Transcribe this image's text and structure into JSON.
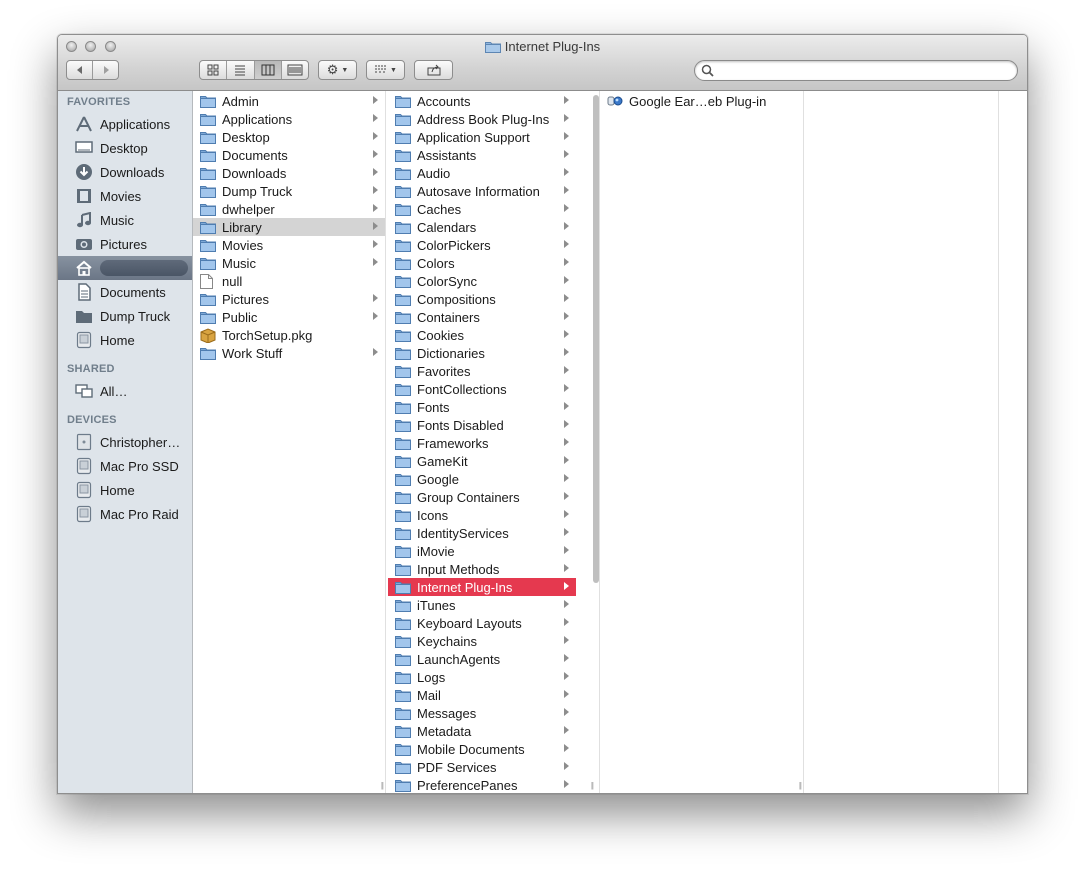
{
  "window": {
    "title": "Internet Plug-Ins"
  },
  "toolbar": {
    "back_icon": "back-arrow-icon",
    "forward_icon": "forward-arrow-icon",
    "views": [
      "icon-view-icon",
      "list-view-icon",
      "column-view-icon",
      "coverflow-view-icon"
    ],
    "active_view": "column",
    "action_icon": "gear-icon",
    "arrange_icon": "arrange-icon",
    "share_icon": "share-icon",
    "search": {
      "value": "",
      "placeholder": ""
    }
  },
  "sidebar": {
    "favorites_header": "FAVORITES",
    "favorites": [
      {
        "label": "Applications",
        "icon": "applications-icon"
      },
      {
        "label": "Desktop",
        "icon": "desktop-icon"
      },
      {
        "label": "Downloads",
        "icon": "downloads-icon"
      },
      {
        "label": "Movies",
        "icon": "movies-icon"
      },
      {
        "label": "Music",
        "icon": "music-icon"
      },
      {
        "label": "Pictures",
        "icon": "pictures-icon"
      },
      {
        "label": "",
        "icon": "home-icon",
        "selected": true
      },
      {
        "label": "Documents",
        "icon": "documents-icon"
      },
      {
        "label": "Dump Truck",
        "icon": "folder-icon"
      },
      {
        "label": "Home",
        "icon": "drive-icon"
      }
    ],
    "shared_header": "SHARED",
    "shared": [
      {
        "label": "All…",
        "icon": "network-icon"
      }
    ],
    "devices_header": "DEVICES",
    "devices": [
      {
        "label": "Christopher…",
        "icon": "computer-icon"
      },
      {
        "label": "Mac Pro SSD",
        "icon": "drive-icon"
      },
      {
        "label": "Home",
        "icon": "drive-icon"
      },
      {
        "label": "Mac Pro Raid",
        "icon": "drive-icon"
      }
    ]
  },
  "column1": {
    "selected": "Library",
    "items": [
      {
        "label": "Admin",
        "kind": "folder",
        "arrow": true
      },
      {
        "label": "Applications",
        "kind": "folder",
        "arrow": true
      },
      {
        "label": "Desktop",
        "kind": "folder",
        "arrow": true
      },
      {
        "label": "Documents",
        "kind": "folder",
        "arrow": true
      },
      {
        "label": "Downloads",
        "kind": "folder",
        "arrow": true
      },
      {
        "label": "Dump Truck",
        "kind": "folder",
        "arrow": true
      },
      {
        "label": "dwhelper",
        "kind": "folder",
        "arrow": true
      },
      {
        "label": "Library",
        "kind": "folder",
        "arrow": true
      },
      {
        "label": "Movies",
        "kind": "folder",
        "arrow": true
      },
      {
        "label": "Music",
        "kind": "folder",
        "arrow": true
      },
      {
        "label": "null",
        "kind": "file",
        "arrow": false
      },
      {
        "label": "Pictures",
        "kind": "folder",
        "arrow": true
      },
      {
        "label": "Public",
        "kind": "folder",
        "arrow": true
      },
      {
        "label": "TorchSetup.pkg",
        "kind": "package",
        "arrow": false
      },
      {
        "label": "Work Stuff",
        "kind": "folder",
        "arrow": true
      }
    ]
  },
  "column2": {
    "selected": "Internet Plug-Ins",
    "items": [
      "Accounts",
      "Address Book Plug-Ins",
      "Application Support",
      "Assistants",
      "Audio",
      "Autosave Information",
      "Caches",
      "Calendars",
      "ColorPickers",
      "Colors",
      "ColorSync",
      "Compositions",
      "Containers",
      "Cookies",
      "Dictionaries",
      "Favorites",
      "FontCollections",
      "Fonts",
      "Fonts Disabled",
      "Frameworks",
      "GameKit",
      "Google",
      "Group Containers",
      "Icons",
      "IdentityServices",
      "iMovie",
      "Input Methods",
      "Internet Plug-Ins",
      "iTunes",
      "Keyboard Layouts",
      "Keychains",
      "LaunchAgents",
      "Logs",
      "Mail",
      "Messages",
      "Metadata",
      "Mobile Documents",
      "PDF Services",
      "PreferencePanes"
    ]
  },
  "column3": {
    "items": [
      {
        "label": "Google Ear…eb Plug-in",
        "kind": "plugin"
      }
    ]
  }
}
